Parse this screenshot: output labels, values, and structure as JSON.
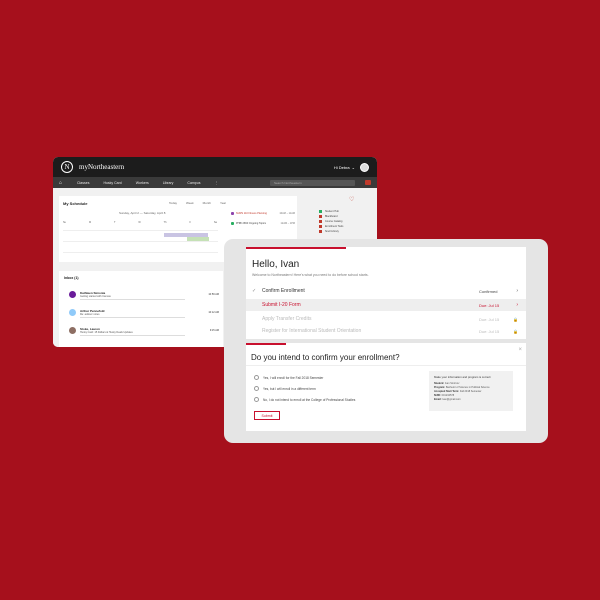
{
  "back": {
    "brand": "myNortheastern",
    "logo": "N",
    "greeting": "Hi Debra",
    "nav": [
      "Classes",
      "Husky Card",
      "Workers",
      "Library",
      "Campus",
      "⋮"
    ],
    "search_placeholder": "Search Northeastern",
    "schedule": {
      "title": "My Schedule",
      "views": [
        "Today",
        "Week",
        "Month",
        "Year"
      ],
      "range": "Sunday, April 2 — Saturday, April 8",
      "days": [
        "Su",
        "M",
        "T",
        "W",
        "Th",
        "F",
        "Sa"
      ],
      "events": [
        {
          "label": "NURS 110 Fitness Planning",
          "time": "10AM – 11AM",
          "color": "#8e44ad"
        },
        {
          "label": "PHBI 2660 Ongoing Topics",
          "time": "12AM – 1PM",
          "color": "#27ae60"
        }
      ]
    },
    "side_links": [
      {
        "label": "Student Hub",
        "color": "#27ae60"
      },
      {
        "label": "Blackboard",
        "color": "#c0392b"
      },
      {
        "label": "Course Catalog",
        "color": "#c0392b"
      },
      {
        "label": "Enrollment Tools",
        "color": "#c0392b"
      },
      {
        "label": "Snell Library",
        "color": "#c0392b"
      }
    ],
    "inbox": {
      "title": "Inbox (1)",
      "messages": [
        {
          "name": "Kathleen Simonia",
          "subject": "Getting started with Canvas",
          "time": "10:59 AM",
          "color": "#6a1b9a"
        },
        {
          "name": "Arthur Pennefold",
          "subject": "Re: advisor notes",
          "time": "10:12 AM",
          "color": "#90caf9"
        },
        {
          "name": "Stoke, Lauren",
          "subject": "Husky Card: 15 Dollars & Husky Deals Updates",
          "time": "9:15 AM",
          "color": "#8d6e63"
        }
      ]
    }
  },
  "front": {
    "hello": "Hello, Ivan",
    "welcome": "Welcome to Northeastern! Here's what you need to do before school starts.",
    "steps": [
      {
        "label": "Confirm Enrollment",
        "status": "Confirmed",
        "end": "›",
        "style": "done"
      },
      {
        "label": "Submit I-20 Form",
        "status": "Due: Jul 15",
        "end": "›",
        "style": "red"
      },
      {
        "label": "Apply Transfer Credits",
        "status": "Due: Jul 15",
        "end": "🔒",
        "style": "dim"
      },
      {
        "label": "Register for International Student Orientation",
        "status": "Due: Jul 15",
        "end": "🔒",
        "style": "dim"
      }
    ],
    "question": "Do you intend to confirm your enrollment?",
    "options": [
      "Yes, I will enroll for the Fall 2018 Semester",
      "Yes, but I will enroll in a different term",
      "No, I do not intend to enroll at the College of Professional Studies"
    ],
    "submit_label": "Submit",
    "close": "×",
    "info": {
      "title": "Make your information and program is correct:",
      "rows": [
        {
          "k": "Student:",
          "v": "Ivan Smirnov"
        },
        {
          "k": "Program:",
          "v": "Bachelor of Science in Political Science"
        },
        {
          "k": "Accepted Start Term:",
          "v": "Fall 2018 Semester"
        },
        {
          "k": "NUID:",
          "v": "001234578"
        },
        {
          "k": "Email:",
          "v": "ivan@gmail.com"
        }
      ]
    }
  }
}
